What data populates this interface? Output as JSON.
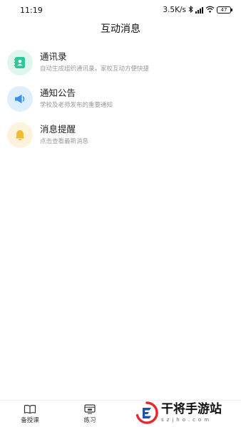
{
  "status_bar": {
    "time": "11:19",
    "network_speed": "3.5K/s",
    "battery_level": "47",
    "icons": [
      "bluetooth-icon",
      "signal-icon",
      "wifi-icon",
      "battery-icon"
    ]
  },
  "header": {
    "title": "互动消息"
  },
  "list": {
    "items": [
      {
        "title": "通讯录",
        "subtitle": "自动生成组织通讯录，家校互动方便快捷",
        "icon": "contact-book-icon",
        "icon_color": "#2fc79a",
        "icon_bg": "#dff6ee"
      },
      {
        "title": "通知公告",
        "subtitle": "学校及老师发布的重要通知",
        "icon": "megaphone-icon",
        "icon_color": "#3a8ef0",
        "icon_bg": "#ddeefc"
      },
      {
        "title": "消息提醒",
        "subtitle": "点击查看最新消息",
        "icon": "bell-icon",
        "icon_color": "#f7b92e",
        "icon_bg": "#fdf3dc"
      }
    ]
  },
  "bottom_nav": {
    "items": [
      {
        "label": "备授课",
        "icon": "book-icon"
      },
      {
        "label": "练习",
        "icon": "practice-icon"
      }
    ]
  },
  "watermark": {
    "title": "干将手游站",
    "subtitle": "szjho.com",
    "accent": "#e8262d",
    "accent2": "#1f4fb0"
  }
}
